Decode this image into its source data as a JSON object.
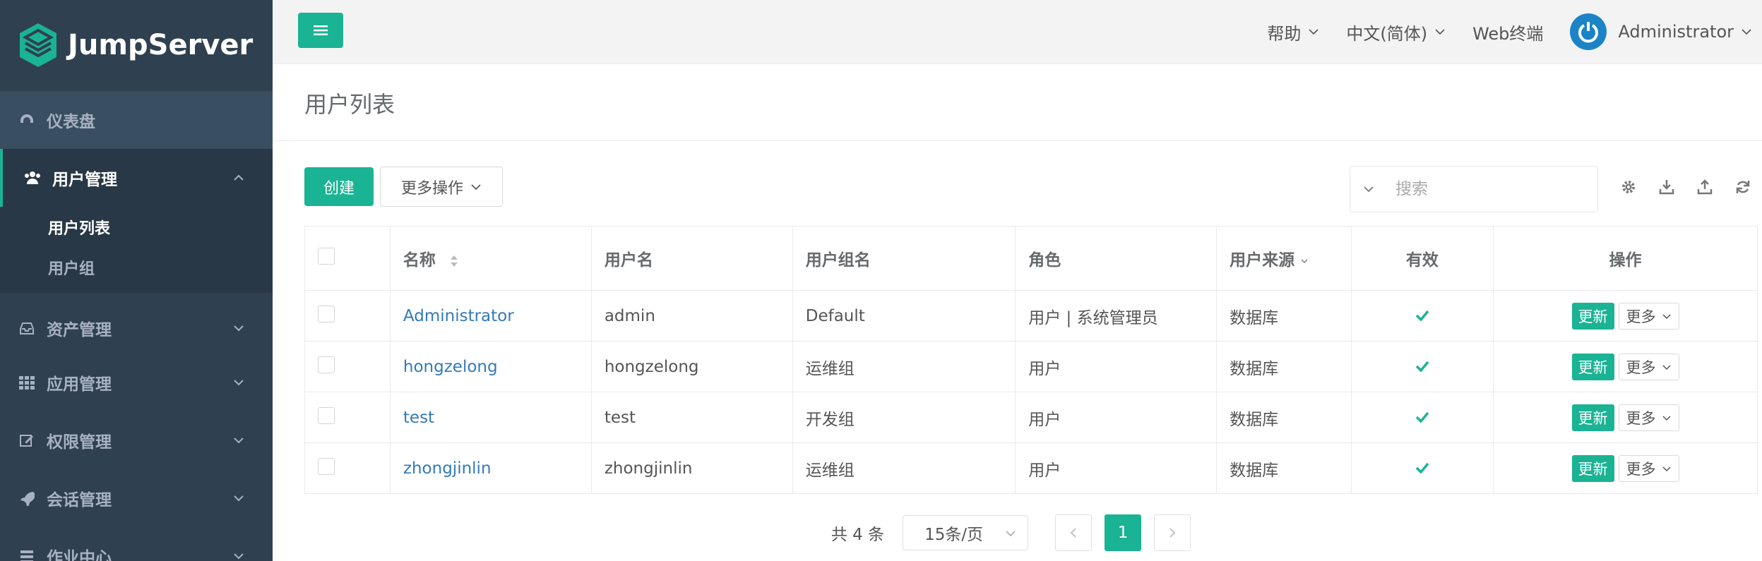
{
  "brand": {
    "name": "JumpServer"
  },
  "sidebar": {
    "items": [
      {
        "label": "仪表盘",
        "icon": "dashboard-icon"
      },
      {
        "label": "用户管理",
        "icon": "users-icon",
        "expanded": true,
        "children": [
          {
            "label": "用户列表",
            "active": true
          },
          {
            "label": "用户组"
          }
        ]
      },
      {
        "label": "资产管理",
        "icon": "inbox-icon"
      },
      {
        "label": "应用管理",
        "icon": "grid-icon"
      },
      {
        "label": "权限管理",
        "icon": "edit-icon"
      },
      {
        "label": "会话管理",
        "icon": "rocket-icon"
      },
      {
        "label": "作业中心",
        "icon": "tasks-icon"
      }
    ]
  },
  "topbar": {
    "help": "帮助",
    "language": "中文(简体)",
    "web_terminal": "Web终端",
    "user": "Administrator"
  },
  "page": {
    "title": "用户列表"
  },
  "toolbar": {
    "create": "创建",
    "more_actions": "更多操作",
    "search_placeholder": "搜索"
  },
  "table": {
    "headers": {
      "name": "名称",
      "username": "用户名",
      "groups": "用户组名",
      "role": "角色",
      "source": "用户来源",
      "valid": "有效",
      "actions": "操作"
    },
    "rows": [
      {
        "name": "Administrator",
        "username": "admin",
        "groups": "Default",
        "role": "用户 | 系统管理员",
        "source": "数据库",
        "valid": true
      },
      {
        "name": "hongzelong",
        "username": "hongzelong",
        "groups": "运维组",
        "role": "用户",
        "source": "数据库",
        "valid": true
      },
      {
        "name": "test",
        "username": "test",
        "groups": "开发组",
        "role": "用户",
        "source": "数据库",
        "valid": true
      },
      {
        "name": "zhongjinlin",
        "username": "zhongjinlin",
        "groups": "运维组",
        "role": "用户",
        "source": "数据库",
        "valid": true
      }
    ],
    "row_actions": {
      "update": "更新",
      "more": "更多"
    }
  },
  "pagination": {
    "total_text": "共 4 条",
    "page_size": "15条/页",
    "current_page": "1"
  },
  "colors": {
    "sidebar": "#2f4050",
    "accent": "#1ab394",
    "link": "#337ab7",
    "avatar": "#1c84c6"
  }
}
